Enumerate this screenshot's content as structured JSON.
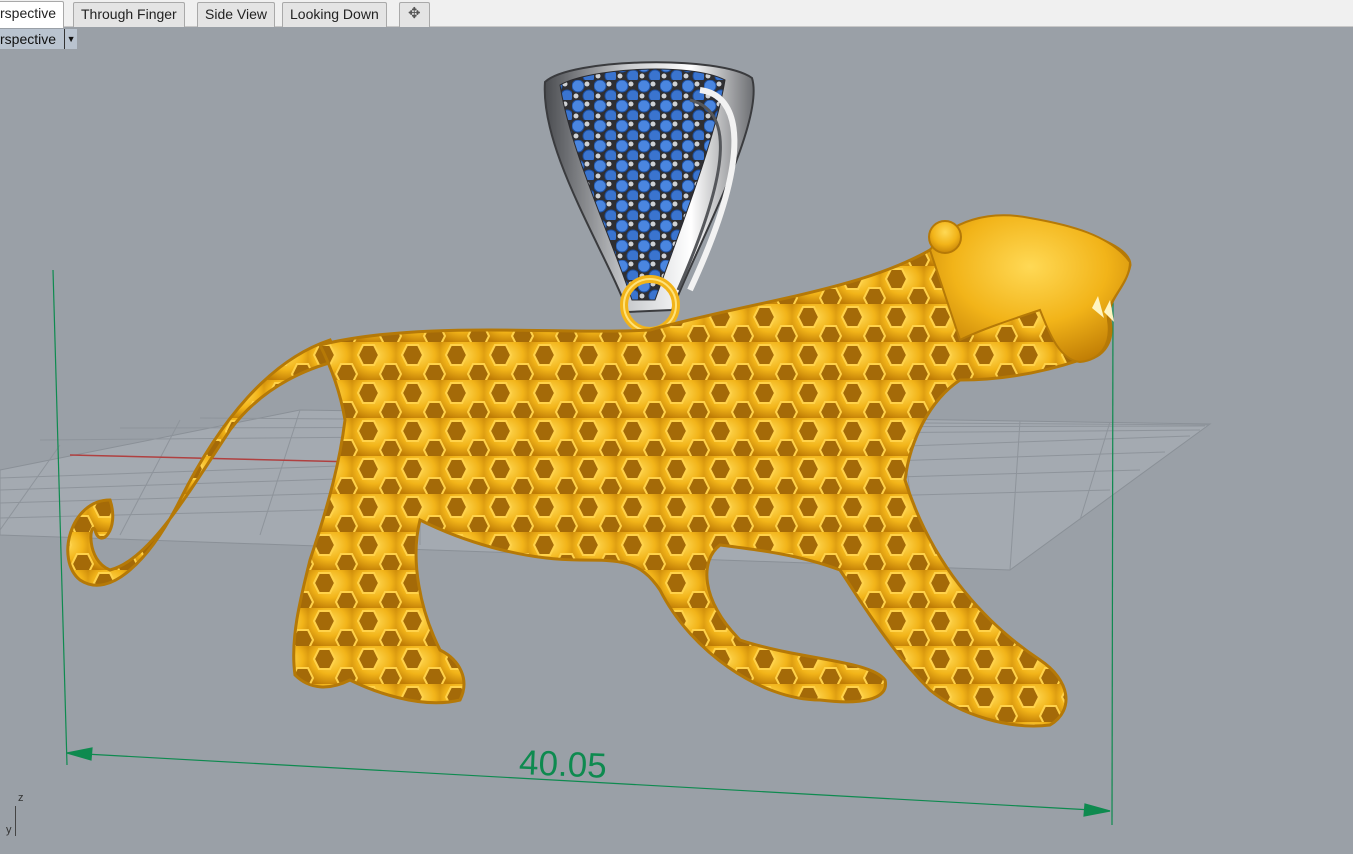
{
  "tabs": [
    {
      "label": "rspective",
      "active": true
    },
    {
      "label": "Through Finger",
      "active": false
    },
    {
      "label": "Side View",
      "active": false
    },
    {
      "label": "Looking Down",
      "active": false
    }
  ],
  "add_tab_icon": "plus-icon",
  "viewport": {
    "label": "rspective",
    "dropdown_icon": "caret-down-icon"
  },
  "dimension": {
    "value": "40.05",
    "color": "#0e8a4f"
  },
  "axis": {
    "z_label": "z",
    "y_label": "y"
  },
  "colors": {
    "gold": "#f2b419",
    "silver": "#a8aaad",
    "gem_blue": "#3f7fd6",
    "background": "#9aa0a7"
  }
}
